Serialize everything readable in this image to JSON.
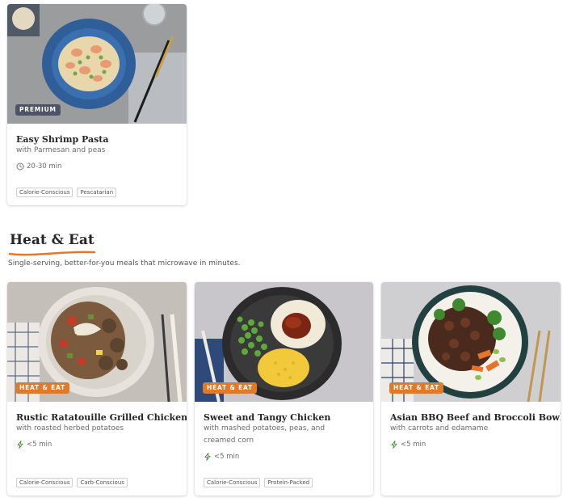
{
  "top_card": {
    "badge": "PREMIUM",
    "title": "Easy Shrimp Pasta",
    "subtitle": "with Parmesan and peas",
    "time": "20-30 min",
    "time_icon": "clock-icon",
    "tags": [
      "Calorie-Conscious",
      "Pescatarian"
    ]
  },
  "section": {
    "title": "Heat & Eat",
    "description": "Single-serving, better-for-you meals that microwave in minutes.",
    "accent_color": "#e07a2b"
  },
  "cards": [
    {
      "badge": "HEAT & EAT",
      "title": "Rustic Ratatouille Grilled Chicken",
      "subtitle": "with roasted herbed potatoes",
      "time": "<5 min",
      "time_icon": "lightning-icon",
      "tags": [
        "Calorie-Conscious",
        "Carb-Conscious"
      ]
    },
    {
      "badge": "HEAT & EAT",
      "title": "Sweet and Tangy Chicken",
      "subtitle": "with mashed potatoes, peas, and creamed corn",
      "time": "<5 min",
      "time_icon": "lightning-icon",
      "tags": [
        "Calorie-Conscious",
        "Protein-Packed"
      ]
    },
    {
      "badge": "HEAT & EAT",
      "title": "Asian BBQ Beef and Broccoli Bowl",
      "subtitle": "with carrots and edamame",
      "time": "<5 min",
      "time_icon": "lightning-icon",
      "tags": []
    }
  ]
}
